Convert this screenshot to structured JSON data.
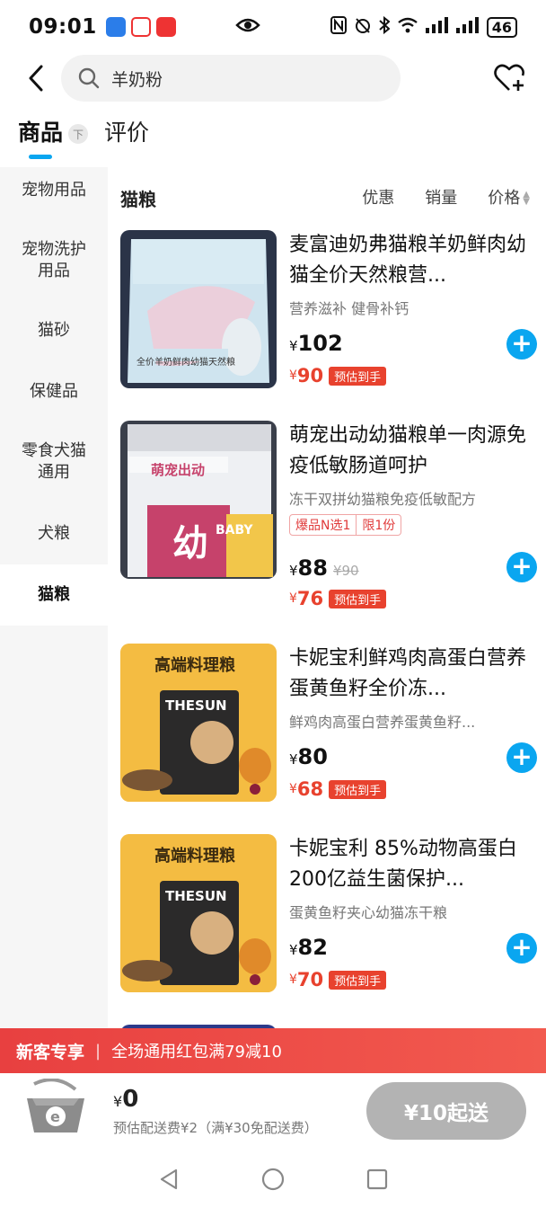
{
  "status_bar": {
    "time": "09:01",
    "battery": "46",
    "signal_label": "6"
  },
  "search": {
    "query": "羊奶粉"
  },
  "tabs": [
    {
      "label": "商品",
      "badge": "下"
    },
    {
      "label": "评价"
    }
  ],
  "sidebar": {
    "items": [
      {
        "label": "宠物用品"
      },
      {
        "label": "宠物洗护用品"
      },
      {
        "label": "猫砂"
      },
      {
        "label": "保健品"
      },
      {
        "label": "零食犬猫通用"
      },
      {
        "label": "犬粮"
      },
      {
        "label": "猫粮"
      }
    ],
    "active_index": 6
  },
  "content": {
    "category": "猫粮",
    "filters": [
      {
        "label": "优惠"
      },
      {
        "label": "销量"
      },
      {
        "label": "价格"
      }
    ]
  },
  "products": [
    {
      "title": "麦富迪奶弗猫粮羊奶鲜肉幼猫全价天然粮营...",
      "subtitle": "营养滋补 健骨补钙",
      "yen": "¥",
      "price": "102",
      "est_yen": "¥",
      "est_price": "90",
      "est_label": "预估到手",
      "image_text": "全价羊奶鲜肉幼猫天然粮"
    },
    {
      "title": "萌宠出动幼猫粮单一肉源免疫低敏肠道呵护",
      "subtitle": "冻干双拼幼猫粮免疫低敏配方",
      "tags": [
        "爆品N选1",
        "限1份"
      ],
      "yen": "¥",
      "price": "88",
      "original_price": "¥90",
      "est_yen": "¥",
      "est_price": "76",
      "est_label": "预估到手",
      "image_text": "萌宠出动",
      "image_text2": "BABY",
      "image_text3": "幼"
    },
    {
      "title": "卡妮宝利鲜鸡肉高蛋白营养蛋黄鱼籽全价冻...",
      "subtitle": "鲜鸡肉高蛋白营养蛋黄鱼籽...",
      "yen": "¥",
      "price": "80",
      "est_yen": "¥",
      "est_price": "68",
      "est_label": "预估到手",
      "image_text": "高端料理粮",
      "image_text2": "THESUN"
    },
    {
      "title": "卡妮宝利 85%动物高蛋白200亿益生菌保护...",
      "subtitle": "蛋黄鱼籽夹心幼猫冻干粮",
      "yen": "¥",
      "price": "82",
      "est_yen": "¥",
      "est_price": "70",
      "est_label": "预估到手",
      "image_text": "高端料理粮",
      "image_text2": "THESUN"
    }
  ],
  "promo": {
    "title": "新客专享",
    "text": "全场通用红包满79减10"
  },
  "cart": {
    "yen": "¥",
    "total": "0",
    "fee_text": "预估配送费¥2（满¥30免配送费）",
    "checkout_label": "¥10起送"
  },
  "colors": {
    "accent": "#0aa6f0",
    "price_red": "#e8422e",
    "promo_red": "#e84040",
    "checkout_gray": "#b3b3b3"
  }
}
